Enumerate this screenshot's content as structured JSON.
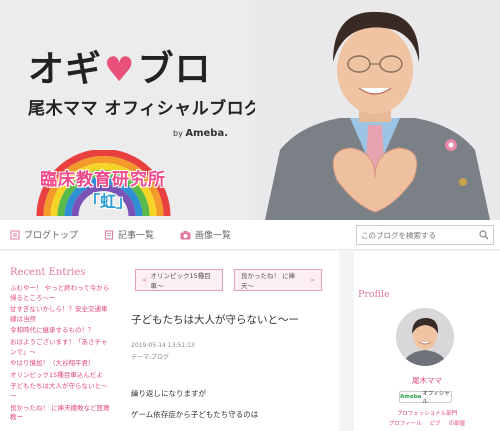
{
  "header": {
    "title_left": "オギ",
    "title_heart": "♥",
    "title_right": "ブロ",
    "subtitle": "尾木ママ オフィシャルブログ",
    "by_text": "by",
    "by_brand": "Ameba.",
    "institute_title": "臨床教育研究所",
    "institute_sub": "「虹」"
  },
  "nav": {
    "items": [
      {
        "label": "ブログトップ",
        "icon": "home-icon"
      },
      {
        "label": "記事一覧",
        "icon": "document-icon"
      },
      {
        "label": "画像一覧",
        "icon": "camera-icon"
      }
    ],
    "search_placeholder": "このブログを検索する"
  },
  "sidebar": {
    "heading": "Recent Entries",
    "entries": [
      "ふむやー！ やっと終わって今から帰るところ〜ー",
      "甘すぎないかしら！？安全交通車線は当然",
      "令和時代に継承するもの！？",
      "おはようございます！「あさチャンで」〜",
      "やはり憶加！（大谷翔平君）",
      "オリンピック15種目車込んだよ",
      "子どもたちは大人が守らないと〜ー",
      "良かったね！ に捧天撒敗など医療教ー"
    ]
  },
  "article": {
    "prev_label": "オリンピック15種目車〜",
    "next_label": "良かったね！ に捧天〜",
    "title": "子どもたちは大人が守らないと〜ー",
    "date": "2019-05-14 13:51:13",
    "theme": "テーマ:ブログ",
    "paragraphs": [
      "繰り返しになりますが",
      "ゲーム依存症から子どもたち守るのは"
    ]
  },
  "profile": {
    "heading": "Profile",
    "name": "尾木ママ",
    "official_brand": "Ameba",
    "official_label": "オフィシャル",
    "category": "プロフェッショナル部門",
    "links": [
      "プロフィール",
      "ピグ",
      "の部屋"
    ]
  },
  "colors": {
    "accent_pink": "#e04a76",
    "heading_pink": "#e07a98",
    "heart_pink": "#e8527a",
    "ameba_green": "#2a9f4a"
  }
}
